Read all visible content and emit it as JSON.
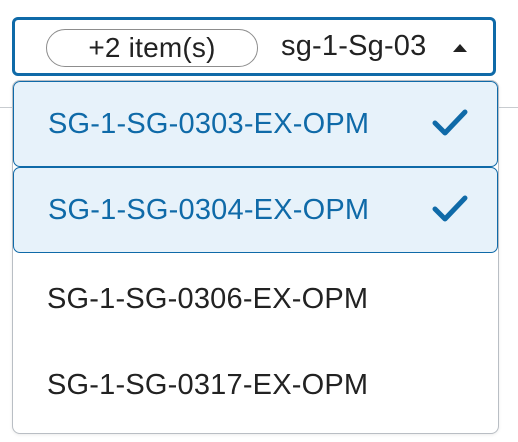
{
  "select": {
    "chip_label": "+2 item(s)",
    "value": "sg-1-Sg-03"
  },
  "options": [
    {
      "label": "SG-1-SG-0303-EX-OPM",
      "selected": true
    },
    {
      "label": "SG-1-SG-0304-EX-OPM",
      "selected": true
    },
    {
      "label": "SG-1-SG-0306-EX-OPM",
      "selected": false
    },
    {
      "label": "SG-1-SG-0317-EX-OPM",
      "selected": false
    }
  ],
  "colors": {
    "accent": "#0f6aa8",
    "selected_bg": "#e7f2fa",
    "text": "#222222",
    "border": "#b9bec4"
  },
  "icons": {
    "caret": "caret-up-icon",
    "check": "checkmark-icon"
  }
}
